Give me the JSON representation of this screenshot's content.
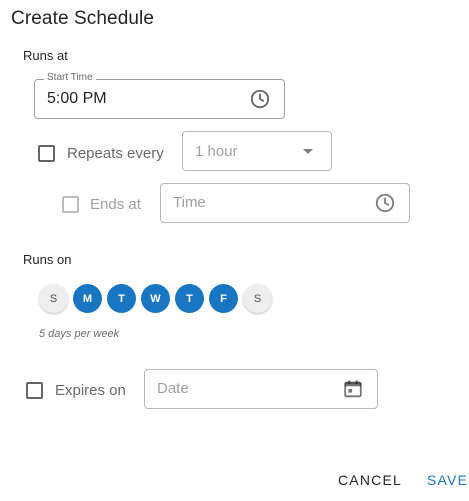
{
  "dialog": {
    "title": "Create Schedule"
  },
  "runs_at": {
    "label": "Runs at",
    "start_time": {
      "legend": "Start Time",
      "value": "5:00 PM",
      "icon": "clock-icon"
    },
    "repeats": {
      "label": "Repeats every",
      "checked": false,
      "value": "1 hour",
      "icon": "dropdown-arrow-icon"
    },
    "ends": {
      "label": "Ends at",
      "checked": false,
      "placeholder": "Time",
      "icon": "clock-icon"
    }
  },
  "runs_on": {
    "label": "Runs on",
    "days": [
      {
        "letter": "S",
        "selected": false
      },
      {
        "letter": "M",
        "selected": true
      },
      {
        "letter": "T",
        "selected": true
      },
      {
        "letter": "W",
        "selected": true
      },
      {
        "letter": "T",
        "selected": true
      },
      {
        "letter": "F",
        "selected": true
      },
      {
        "letter": "S",
        "selected": false
      }
    ],
    "summary": "5 days per week"
  },
  "expires": {
    "label": "Expires on",
    "checked": false,
    "placeholder": "Date",
    "icon": "calendar-icon"
  },
  "actions": {
    "cancel": "CANCEL",
    "save": "SAVE"
  },
  "colors": {
    "accent": "#1976c2",
    "day_off_bg": "#eeeeee"
  }
}
